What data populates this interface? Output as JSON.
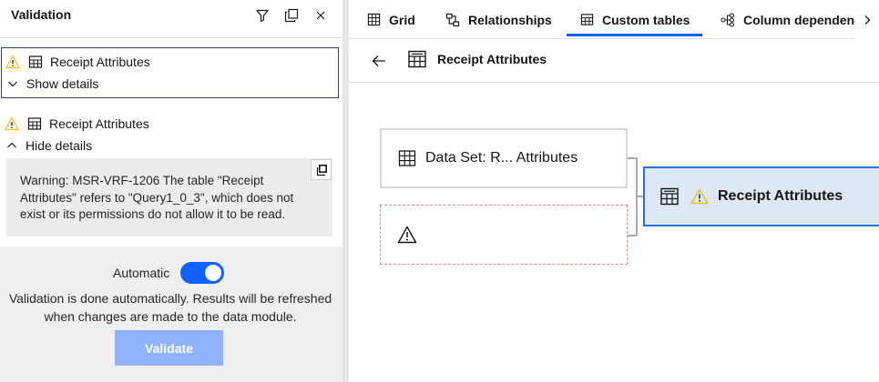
{
  "validation_panel": {
    "title": "Validation",
    "icons": {
      "filter": "filter-icon",
      "copy_all": "copy-icon",
      "close": "close-icon"
    },
    "items": [
      {
        "name": "Receipt Attributes",
        "toggle_label": "Show details",
        "expanded": false,
        "selected": true
      },
      {
        "name": "Receipt Attributes",
        "toggle_label": "Hide details",
        "expanded": true,
        "message_lines": [
          "Warning: MSR-VRF-1206 The table \"Receipt",
          "Attributes\" refers to \"Query1_0_3\", which does not",
          "exist or its permissions do not allow it to be read."
        ]
      }
    ],
    "automatic_label": "Automatic",
    "automatic_enabled": true,
    "description_lines": [
      "Validation is done automatically. Results will be refreshed",
      "when changes are made to the data module."
    ],
    "validate_label": "Validate"
  },
  "tabs": [
    {
      "label": "Grid",
      "icon": "grid-icon",
      "active": false
    },
    {
      "label": "Relationships",
      "icon": "relationships-icon",
      "active": false
    },
    {
      "label": "Custom tables",
      "icon": "custom-table-icon",
      "active": true
    },
    {
      "label": "Column dependenc",
      "icon": "column-dependency-icon",
      "active": false
    }
  ],
  "subheader": {
    "title": "Receipt Attributes",
    "back_icon": "arrow-left-icon",
    "table_icon": "custom-table-icon"
  },
  "diagram": {
    "source_node": {
      "label": "Data Set: R... Attributes",
      "icon": "table-icon"
    },
    "error_node": {
      "icon": "warning-icon"
    },
    "target_node": {
      "label": "Receipt Attributes",
      "icon": "custom-table-icon",
      "status_icon": "warning-icon"
    }
  },
  "colors": {
    "accent": "#0f62fe",
    "warning": "#f1c21b",
    "validate_disabled": "#8fb3ff",
    "selected_node_bg": "#dde8f6",
    "selected_node_border": "#2b72d6",
    "error_border": "#e58b8b"
  }
}
